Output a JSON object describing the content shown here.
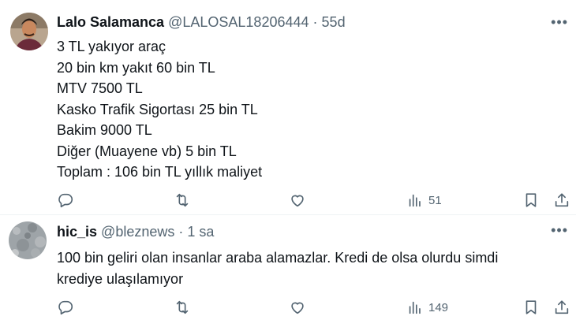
{
  "tweets": [
    {
      "name": "Lalo Salamanca",
      "handle": "@LALOSAL18206444",
      "separator": "·",
      "time": "55d",
      "more": "•••",
      "lines": [
        "3 TL yakıyor araç",
        "20 bin km yakıt 60 bin TL",
        "MTV 7500 TL",
        "Kasko Trafik Sigortası 25 bin TL",
        "Bakim 9000 TL",
        "Diğer (Muayene vb) 5 bin TL",
        "Toplam : 106 bin TL yıllık maliyet"
      ],
      "views": "51"
    },
    {
      "name": "hic_is",
      "handle": "@bleznews",
      "separator": "·",
      "time": "1 sa",
      "more": "•••",
      "lines": [
        "100 bin geliri olan insanlar araba alamazlar.  Kredi de olsa olurdu simdi",
        "krediye ulaşılamıyor"
      ],
      "views": "149"
    }
  ],
  "icons": {
    "reply": "reply-icon",
    "retweet": "retweet-icon",
    "like": "heart-icon",
    "views": "views-icon",
    "bookmark": "bookmark-icon",
    "share": "share-icon"
  },
  "colors": {
    "text": "#0f1419",
    "secondary": "#536471",
    "divider": "#eff3f4"
  }
}
